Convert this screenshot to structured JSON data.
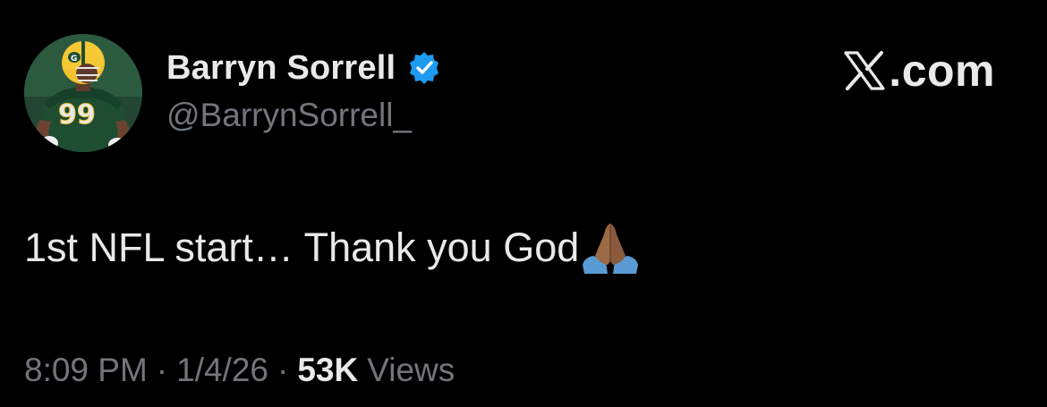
{
  "author": {
    "display_name": "Barryn Sorrell",
    "handle": "@BarrynSorrell_",
    "verified": true,
    "avatar_icon": "player-avatar",
    "badge_color": "#1d9bf0"
  },
  "brand": {
    "icon": "x-logo-icon",
    "text": ".com"
  },
  "tweet": {
    "text": "1st NFL start… Thank you God",
    "emoji": "folded-hands-icon"
  },
  "meta": {
    "time": "8:09 PM",
    "separator": "·",
    "date": "1/4/26",
    "views_count": "53K",
    "views_label": "Views"
  },
  "colors": {
    "background": "#000000",
    "primary_text": "#e7e9ea",
    "secondary_text": "#71767b",
    "verified_blue": "#1d9bf0"
  }
}
